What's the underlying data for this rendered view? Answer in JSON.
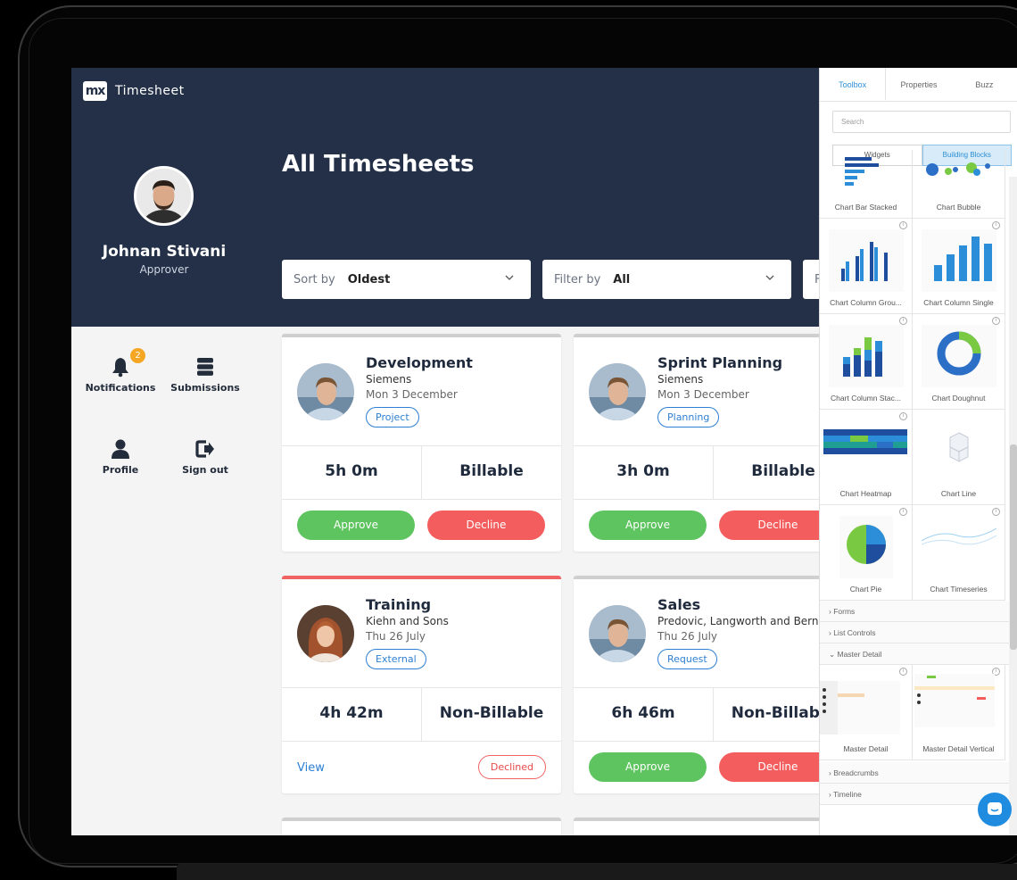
{
  "app": {
    "logo": "mx",
    "name": "Timesheet"
  },
  "user": {
    "name": "Johnan Stivani",
    "role": "Approver"
  },
  "page": {
    "title": "All Timesheets"
  },
  "filters": {
    "sort_label": "Sort by",
    "sort_value": "Oldest",
    "filter_label": "Filter by",
    "filter_value": "All",
    "third_label": "F"
  },
  "sidebar": {
    "items": [
      {
        "label": "Notifications",
        "icon": "bell-icon",
        "badge": "2"
      },
      {
        "label": "Submissions",
        "icon": "server-stack-icon"
      },
      {
        "label": "Profile",
        "icon": "user-icon"
      },
      {
        "label": "Sign out",
        "icon": "sign-out-icon"
      }
    ]
  },
  "cards": [
    {
      "title": "Development",
      "company": "Siemens",
      "date": "Mon 3 December",
      "tag": "Project",
      "hours": "5h 0m",
      "billing": "Billable",
      "approve": "Approve",
      "decline": "Decline"
    },
    {
      "title": "Sprint Planning",
      "company": "Siemens",
      "date": "Mon 3 December",
      "tag": "Planning",
      "hours": "3h 0m",
      "billing": "Billable",
      "approve": "Approve",
      "decline": "Decline"
    },
    {
      "title": "Training",
      "company": "Kiehn and Sons",
      "date": "Thu 26 July",
      "tag": "External",
      "hours": "4h 42m",
      "billing": "Non-Billable",
      "view": "View",
      "status": "Declined"
    },
    {
      "title": "Sales",
      "company": "Predovic, Langworth and Bernier",
      "date": "Thu 26 July",
      "tag": "Request",
      "hours": "6h 46m",
      "billing": "Non-Billable",
      "approve": "Approve",
      "decline": "Decline"
    }
  ],
  "toolbox": {
    "tabs": [
      "Toolbox",
      "Properties",
      "Buzz"
    ],
    "search_placeholder": "Search",
    "segments": [
      "Widgets",
      "Building Blocks"
    ],
    "tiles": [
      "Chart Bar Stacked",
      "Chart Bubble",
      "Chart Column Grou...",
      "Chart Column Single",
      "Chart Column Stac...",
      "Chart Doughnut",
      "Chart Heatmap",
      "Chart Line",
      "Chart Pie",
      "Chart Timeseries"
    ],
    "categories": [
      "Forms",
      "List Controls",
      "Master Detail"
    ],
    "detail_tiles": [
      "Master Detail",
      "Master Detail Vertical"
    ],
    "bottom_categories": [
      "Breadcrumbs",
      "Timeline"
    ]
  },
  "colors": {
    "header": "#233047",
    "approve": "#5ec45f",
    "decline": "#f45d5d",
    "accent": "#2d7fd3",
    "badge": "#f5a623"
  }
}
